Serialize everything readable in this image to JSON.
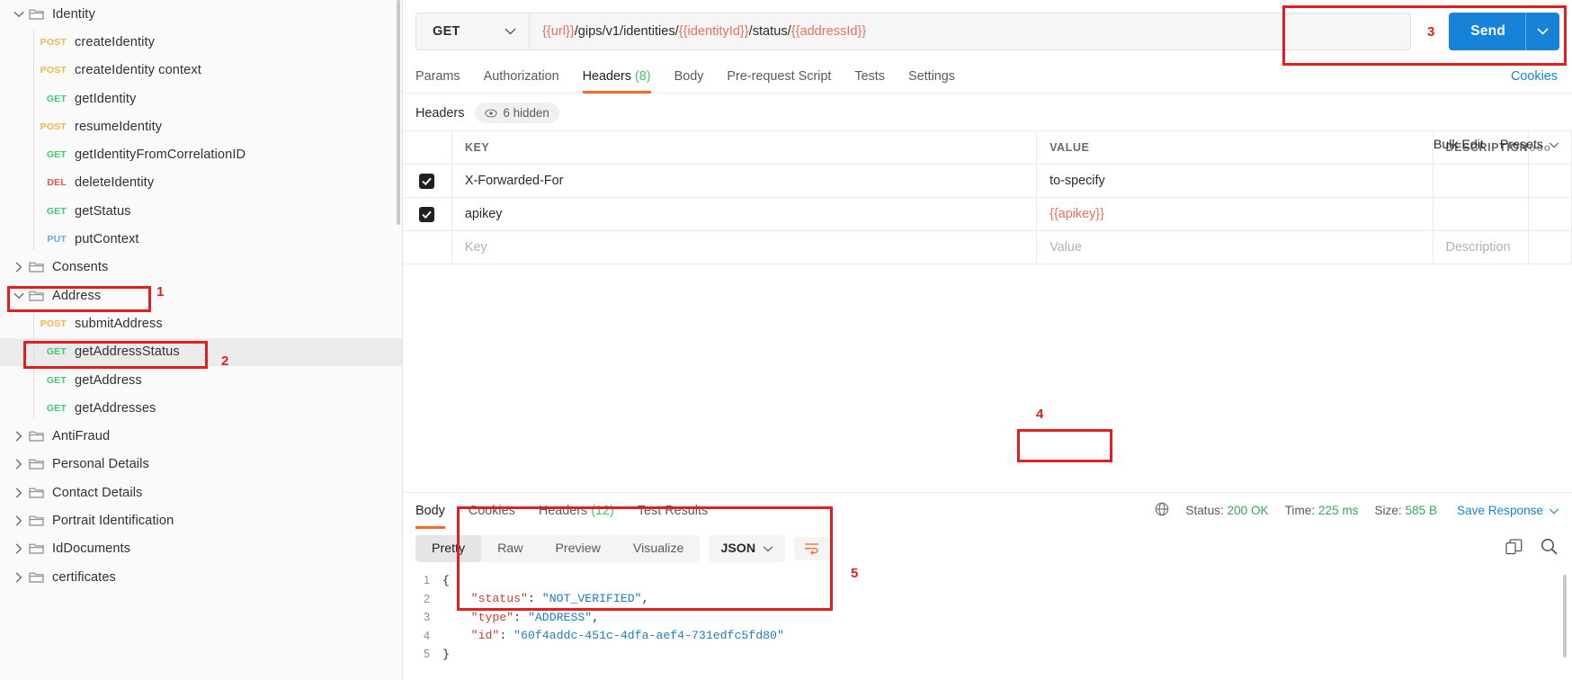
{
  "sidebar": {
    "tree": [
      {
        "kind": "folder",
        "label": "Identity",
        "expanded": true
      },
      {
        "kind": "request",
        "method": "POST",
        "label": "createIdentity"
      },
      {
        "kind": "request",
        "method": "POST",
        "label": "createIdentity context"
      },
      {
        "kind": "request",
        "method": "GET",
        "label": "getIdentity"
      },
      {
        "kind": "request",
        "method": "POST",
        "label": "resumeIdentity"
      },
      {
        "kind": "request",
        "method": "GET",
        "label": "getIdentityFromCorrelationID"
      },
      {
        "kind": "request",
        "method": "DEL",
        "label": "deleteIdentity"
      },
      {
        "kind": "request",
        "method": "GET",
        "label": "getStatus"
      },
      {
        "kind": "request",
        "method": "PUT",
        "label": "putContext"
      },
      {
        "kind": "folder",
        "label": "Consents",
        "expanded": false
      },
      {
        "kind": "folder",
        "label": "Address",
        "expanded": true
      },
      {
        "kind": "request",
        "method": "POST",
        "label": "submitAddress"
      },
      {
        "kind": "request",
        "method": "GET",
        "label": "getAddressStatus",
        "selected": true
      },
      {
        "kind": "request",
        "method": "GET",
        "label": "getAddress"
      },
      {
        "kind": "request",
        "method": "GET",
        "label": "getAddresses"
      },
      {
        "kind": "folder",
        "label": "AntiFraud",
        "expanded": false
      },
      {
        "kind": "folder",
        "label": "Personal Details",
        "expanded": false
      },
      {
        "kind": "folder",
        "label": "Contact Details",
        "expanded": false
      },
      {
        "kind": "folder",
        "label": "Portrait Identification",
        "expanded": false
      },
      {
        "kind": "folder",
        "label": "IdDocuments",
        "expanded": false
      },
      {
        "kind": "folder",
        "label": "certificates",
        "expanded": false
      }
    ]
  },
  "request": {
    "method": "GET",
    "url_parts": [
      {
        "t": "{{url}}",
        "var": true
      },
      {
        "t": "/gips/v1/identities/",
        "var": false
      },
      {
        "t": "{{identityId}}",
        "var": true
      },
      {
        "t": "/status/",
        "var": false
      },
      {
        "t": "{{addressId}}",
        "var": true
      }
    ],
    "url_plain": "{{url}}/gips/v1/identities/{{identityId}}/status/{{addressId}}",
    "send_label": "Send",
    "cookies_link": "Cookies",
    "tabs": [
      {
        "label": "Params",
        "active": false
      },
      {
        "label": "Authorization",
        "active": false
      },
      {
        "label": "Headers",
        "count": "(8)",
        "active": true
      },
      {
        "label": "Body",
        "active": false
      },
      {
        "label": "Pre-request Script",
        "active": false
      },
      {
        "label": "Tests",
        "active": false
      },
      {
        "label": "Settings",
        "active": false
      }
    ]
  },
  "headers_panel": {
    "title": "Headers",
    "hidden_pill": "6 hidden",
    "columns": [
      "KEY",
      "VALUE",
      "DESCRIPTION"
    ],
    "bulk_edit": "Bulk Edit",
    "presets": "Presets",
    "rows": [
      {
        "checked": true,
        "key": "X-Forwarded-For",
        "value": "to-specify",
        "value_is_var": false,
        "description": ""
      },
      {
        "checked": true,
        "key": "apikey",
        "value": "{{apikey}}",
        "value_is_var": true,
        "description": ""
      }
    ],
    "placeholder_row": {
      "key": "Key",
      "value": "Value",
      "description": "Description"
    }
  },
  "response": {
    "tabs": [
      {
        "label": "Body",
        "active": true
      },
      {
        "label": "Cookies",
        "active": false
      },
      {
        "label": "Headers",
        "count": "(12)",
        "active": false
      },
      {
        "label": "Test Results",
        "active": false
      }
    ],
    "status_label": "Status:",
    "status_value": "200 OK",
    "time_label": "Time:",
    "time_value": "225 ms",
    "size_label": "Size:",
    "size_value": "585 B",
    "save_response": "Save Response",
    "view_modes": [
      {
        "label": "Pretty",
        "active": true
      },
      {
        "label": "Raw",
        "active": false
      },
      {
        "label": "Preview",
        "active": false
      },
      {
        "label": "Visualize",
        "active": false
      }
    ],
    "format": "JSON",
    "body_lines": [
      {
        "n": "1",
        "segments": [
          {
            "t": "{",
            "c": "j-brace"
          }
        ]
      },
      {
        "n": "2",
        "segments": [
          {
            "t": "    ",
            "c": ""
          },
          {
            "t": "\"status\"",
            "c": "j-key"
          },
          {
            "t": ": ",
            "c": ""
          },
          {
            "t": "\"NOT_VERIFIED\"",
            "c": "j-str"
          },
          {
            "t": ",",
            "c": ""
          }
        ]
      },
      {
        "n": "3",
        "segments": [
          {
            "t": "    ",
            "c": ""
          },
          {
            "t": "\"type\"",
            "c": "j-key"
          },
          {
            "t": ": ",
            "c": ""
          },
          {
            "t": "\"ADDRESS\"",
            "c": "j-str"
          },
          {
            "t": ",",
            "c": ""
          }
        ]
      },
      {
        "n": "4",
        "segments": [
          {
            "t": "    ",
            "c": ""
          },
          {
            "t": "\"id\"",
            "c": "j-key"
          },
          {
            "t": ": ",
            "c": ""
          },
          {
            "t": "\"60f4addc-451c-4dfa-aef4-731edfc5fd80\"",
            "c": "j-str"
          }
        ]
      },
      {
        "n": "5",
        "segments": [
          {
            "t": "}",
            "c": "j-brace"
          }
        ]
      }
    ]
  },
  "annotations": {
    "one": "1",
    "two": "2",
    "three": "3",
    "four": "4",
    "five": "5"
  },
  "colors": {
    "accent_orange": "#f06b29",
    "send_blue": "#1683d8",
    "annotation_red": "#e02020",
    "get_green": "#3ec96c",
    "post_yellow": "#f3b64b",
    "del_red": "#e8544a",
    "put_blue": "#5fa9ef",
    "var_red": "#e8705f"
  }
}
